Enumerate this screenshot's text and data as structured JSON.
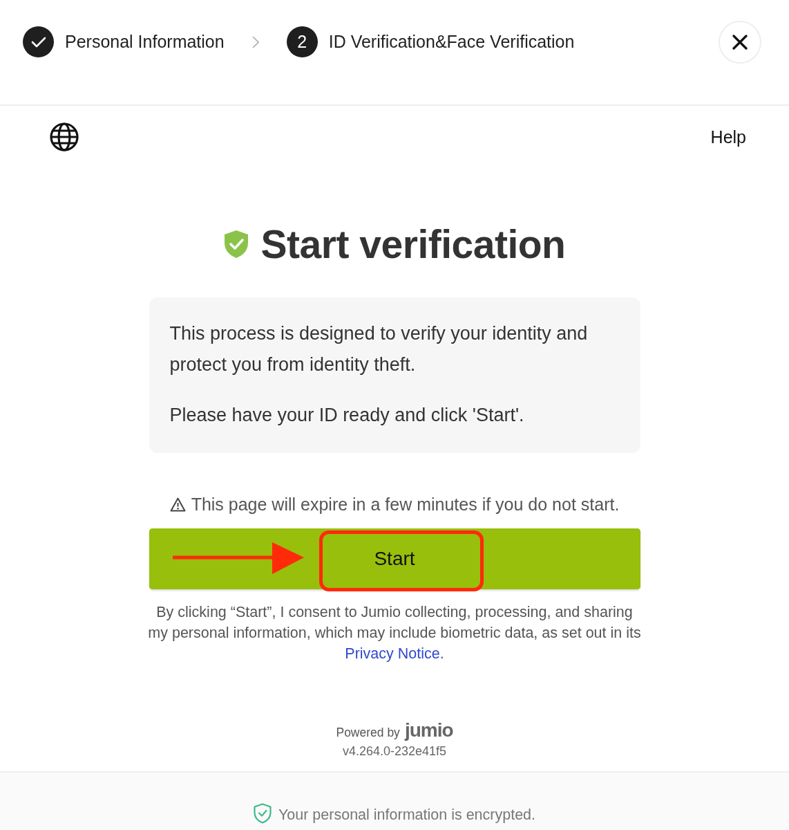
{
  "steps": [
    {
      "label": "Personal Information",
      "completed": true
    },
    {
      "label": "ID Verification&Face Verification",
      "number": "2",
      "completed": false
    }
  ],
  "help": "Help",
  "title": "Start verification",
  "info_paragraphs": [
    "This process is designed to verify your identity and protect you from identity theft.",
    "Please have your ID ready and click 'Start'."
  ],
  "expiry_warning": "This page will expire in a few minutes if you do not start.",
  "start_button": {
    "label": "Start",
    "highlighted": true
  },
  "pointer_arrow": true,
  "consent": {
    "text": "By clicking “Start”, I consent to Jumio collecting, processing, and sharing my personal information, which may include biometric data, as set out in its",
    "link": "Privacy Notice",
    "end": "."
  },
  "powered_by": "Powered by",
  "logo": "jumio",
  "version": "v4.264.0-232e41f5",
  "footer": "Your personal information is encrypted."
}
